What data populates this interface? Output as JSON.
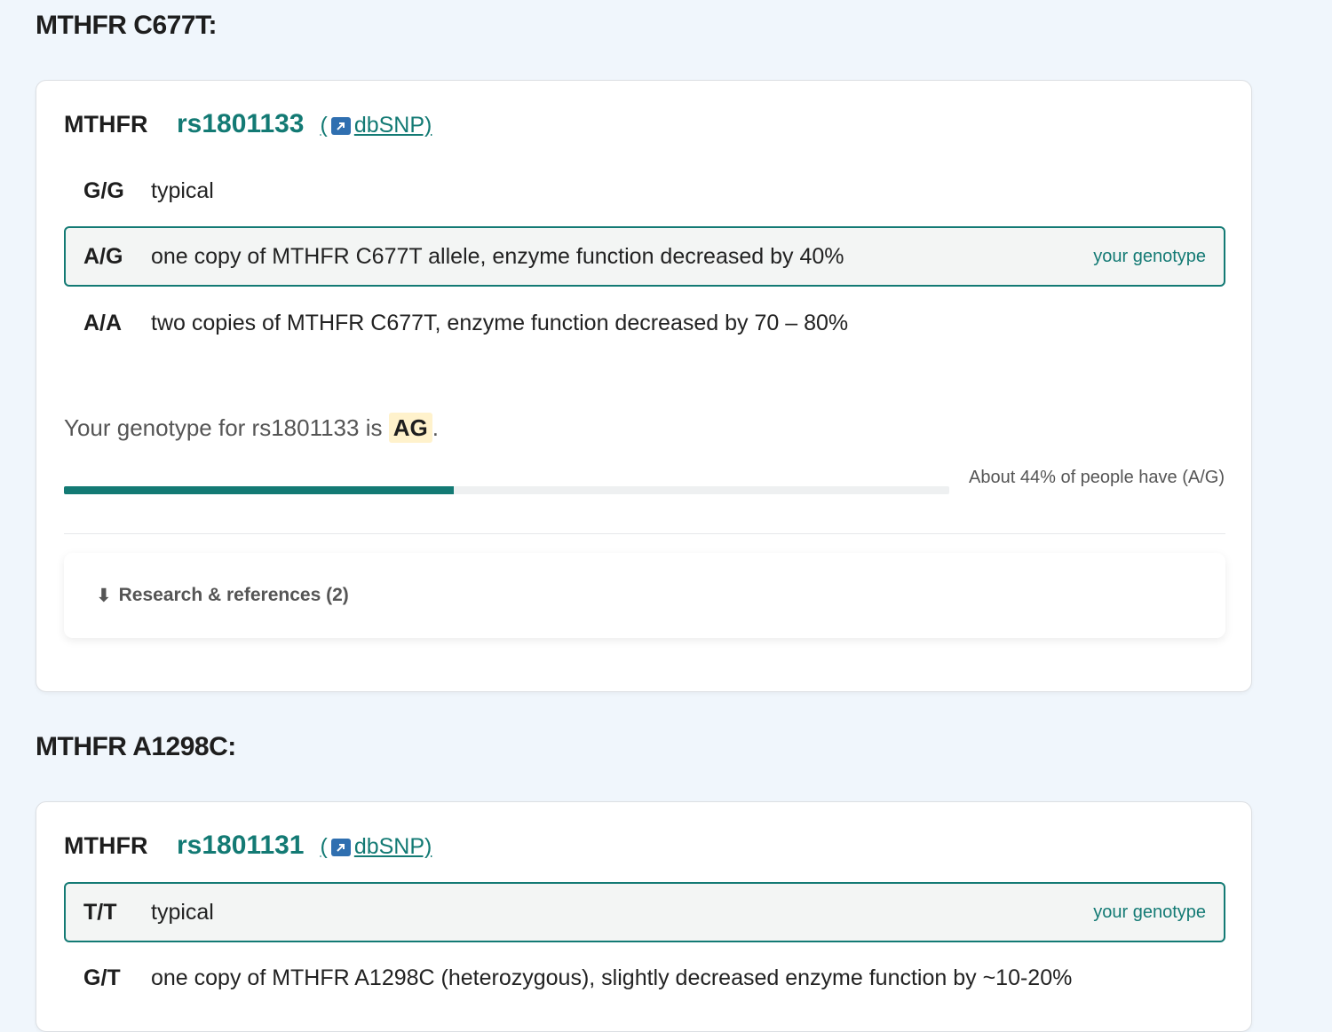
{
  "sections": [
    {
      "title": "MTHFR C677T:",
      "gene": "MTHFR",
      "rsid": "rs1801133",
      "dbsnp_label": "dbSNP)",
      "dbsnp_open": "(",
      "genotypes": [
        {
          "gt": "G/G",
          "desc": "typical"
        },
        {
          "gt": "A/G",
          "desc": "one copy of MTHFR C677T allele, enzyme function decreased by 40%",
          "yours": "your genotype"
        },
        {
          "gt": "A/A",
          "desc": "two copies of MTHFR C677T, enzyme function decreased by 70 – 80%"
        }
      ],
      "your_genotype_prefix": "Your genotype for rs1801133 is",
      "your_genotype_value": "AG",
      "your_genotype_suffix": ".",
      "frequency_percent": 44,
      "frequency_text": "About 44% of people have (A/G)",
      "research_label": "Research & references (2)"
    },
    {
      "title": "MTHFR A1298C:",
      "gene": "MTHFR",
      "rsid": "rs1801131",
      "dbsnp_label": "dbSNP)",
      "dbsnp_open": "(",
      "genotypes": [
        {
          "gt": "T/T",
          "desc": "typical",
          "yours": "your genotype"
        },
        {
          "gt": "G/T",
          "desc": "one copy of MTHFR A1298C (heterozygous), slightly decreased enzyme function by ~10-20%"
        }
      ]
    }
  ],
  "icons": {
    "external_link": "external-link-icon",
    "research_arrow": "⬇"
  },
  "colors": {
    "accent": "#137a74",
    "highlight": "#fff2cc",
    "page_bg": "#f0f6fc"
  }
}
